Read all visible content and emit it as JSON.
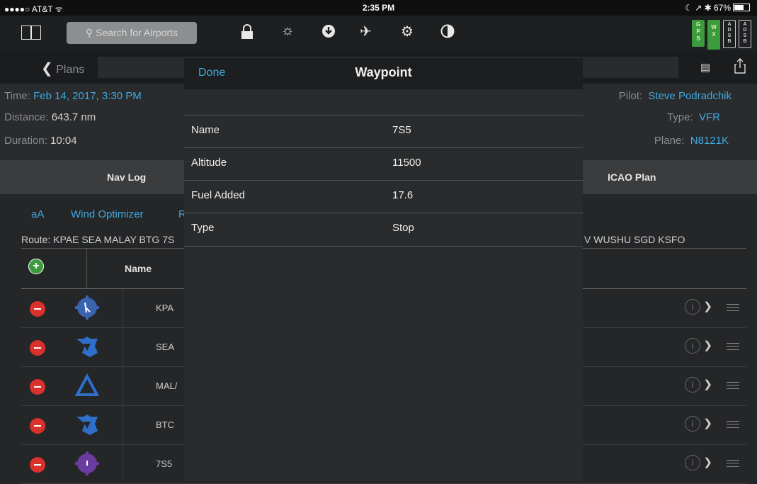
{
  "status_bar": {
    "carrier": "●●●●○ AT&T ᯤ",
    "time": "2:35 PM",
    "right": "☾ ↗ ✱ 67%"
  },
  "toolbar": {
    "search_placeholder": "Search for Airports",
    "badges": [
      {
        "label": "G P S",
        "color": "#3c9b3c"
      },
      {
        "label": "W X",
        "color": "#3c9b3c"
      },
      {
        "label": "A D S B",
        "color": "#d0d0d0"
      },
      {
        "label": "A D S B",
        "color": "#d0d0d0"
      }
    ]
  },
  "plan_bar": {
    "back_label": "Plans"
  },
  "plan_info": {
    "time_label": "Time:",
    "time_value": "Feb 14, 2017, 3:30 PM",
    "distance_label": "Distance:",
    "distance_value": "643.7 nm",
    "duration_label": "Duration:",
    "duration_value": "10:04",
    "pilot_label": "Pilot:",
    "pilot_value": "Steve Podradchik",
    "type_label": "Type:",
    "type_value": "VFR",
    "plane_label": "Plane:",
    "plane_value": "N8121K"
  },
  "tabs": {
    "nav_log": "Nav Log",
    "icao_plan": "ICAO Plan"
  },
  "links": {
    "text_size": "aA",
    "wind_optimizer": "Wind Optimizer",
    "partial": "R"
  },
  "route": {
    "left": "Route: KPAE SEA MALAY BTG 7S",
    "right": "V WUSHU SGD KSFO"
  },
  "table": {
    "name_header": "Name",
    "rows": [
      {
        "name": "KPA",
        "icon": "airport-icon",
        "color": "#3a64b0"
      },
      {
        "name": "SEA",
        "icon": "vortac-icon",
        "color": "#2e6fc9"
      },
      {
        "name": "MAL/",
        "icon": "intersection-icon",
        "color": "#2e6fc9"
      },
      {
        "name": "BTC",
        "icon": "vortac-icon",
        "color": "#2e6fc9"
      },
      {
        "name": "7S5",
        "icon": "airport-icon",
        "color": "#6a3ca0"
      }
    ]
  },
  "modal": {
    "done": "Done",
    "title": "Waypoint",
    "fields": [
      {
        "label": "Name",
        "value": "7S5"
      },
      {
        "label": "Altitude",
        "value": "11500"
      },
      {
        "label": "Fuel Added",
        "value": "17.6"
      },
      {
        "label": "Type",
        "value": "Stop"
      }
    ]
  }
}
